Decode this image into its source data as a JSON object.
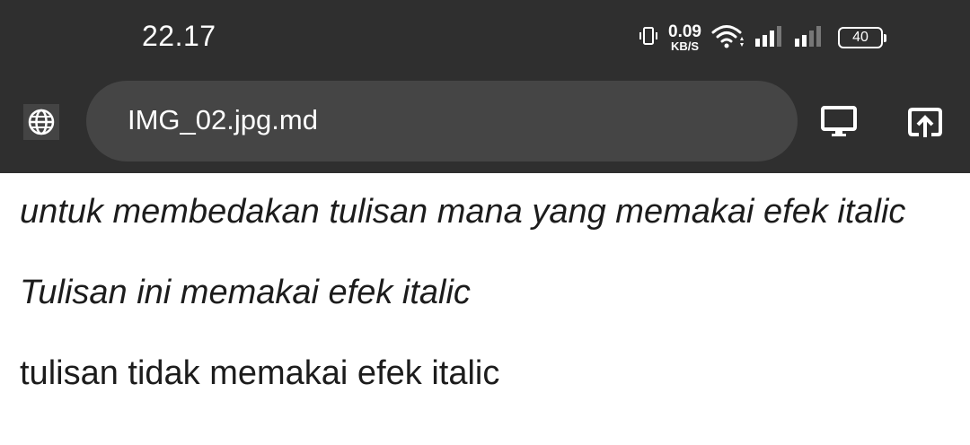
{
  "status_bar": {
    "time": "22.17",
    "net_speed_value": "0.09",
    "net_speed_unit": "KB/S",
    "battery_level": "40",
    "icons": [
      "vibrate-icon",
      "wifi-icon",
      "signal-sim1-icon",
      "signal-sim2-icon",
      "battery-icon"
    ]
  },
  "address_bar": {
    "url": "IMG_02.jpg.md",
    "left_icon": "globe-icon",
    "right_icons": [
      "desktop-site-icon",
      "share-icon"
    ]
  },
  "document": {
    "paragraphs": [
      {
        "text": "untuk membedakan tulisan mana yang memakai efek italic",
        "style": "italic"
      },
      {
        "text": "Tulisan ini memakai efek italic",
        "style": "italic"
      },
      {
        "text": "tulisan tidak memakai efek italic",
        "style": "normal"
      }
    ]
  },
  "colors": {
    "topbar_bg": "#2f2f2f",
    "url_pill_bg": "#454545",
    "page_bg": "#ffffff",
    "text": "#1c1c1c"
  }
}
